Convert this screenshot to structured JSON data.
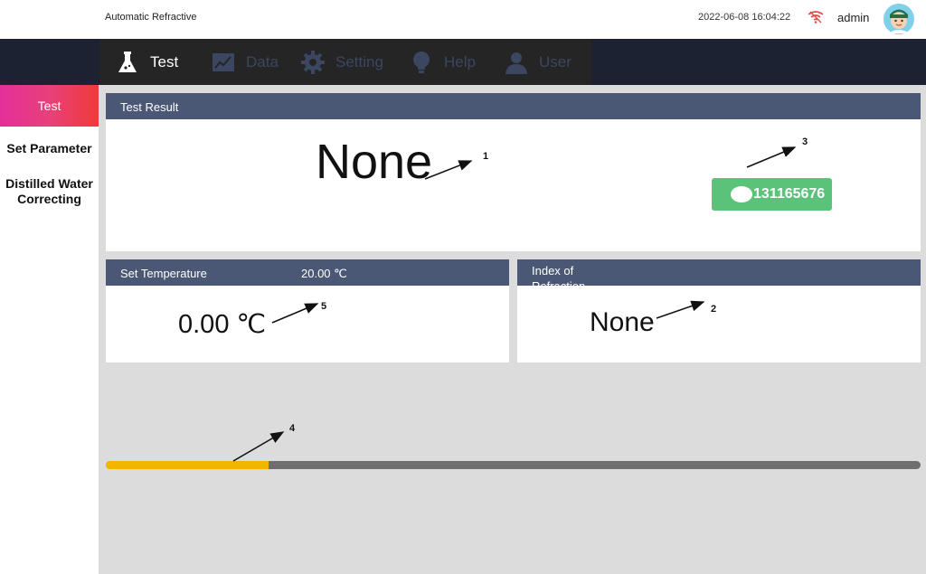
{
  "header": {
    "app_title": "Automatic Refractive",
    "datetime": "2022-06-08 16:04:22",
    "user": "admin",
    "wifi_icon": "wifi-off-icon",
    "avatar_icon": "user-avatar-icon"
  },
  "nav": {
    "items": [
      {
        "label": "Test",
        "icon": "flask-icon",
        "active": true
      },
      {
        "label": "Data",
        "icon": "chart-icon",
        "active": false
      },
      {
        "label": "Setting",
        "icon": "gear-icon",
        "active": false
      },
      {
        "label": "Help",
        "icon": "bulb-icon",
        "active": false
      },
      {
        "label": "User",
        "icon": "user-icon",
        "active": false
      }
    ]
  },
  "sidebar": {
    "items": [
      {
        "label": "Test",
        "active": true
      },
      {
        "label": "Set Parameter",
        "active": false
      },
      {
        "label": "Distilled Water Correcting",
        "line1": "Distilled Water",
        "line2": "Correcting",
        "active": false
      }
    ]
  },
  "test_result": {
    "title": "Test Result",
    "value": "None",
    "serial": "131165676"
  },
  "temperature": {
    "title": "Set Temperature",
    "set_value": "20.00 ℃",
    "current": "0.00 ℃"
  },
  "refraction": {
    "title_line1": "Index of",
    "title_line2": "Refraction",
    "value": "None"
  },
  "progress": {
    "fraction": 0.2
  },
  "callouts": {
    "c1": "1",
    "c2": "2",
    "c3": "3",
    "c4": "4",
    "c5": "5"
  },
  "colors": {
    "accent_gradient_start": "#e32f9a",
    "accent_gradient_end": "#f03a3a",
    "panel_header": "#4a5876",
    "nav_bg": "#1d2233",
    "progress_fill": "#f4b400",
    "serial_button": "#5bc27a"
  }
}
